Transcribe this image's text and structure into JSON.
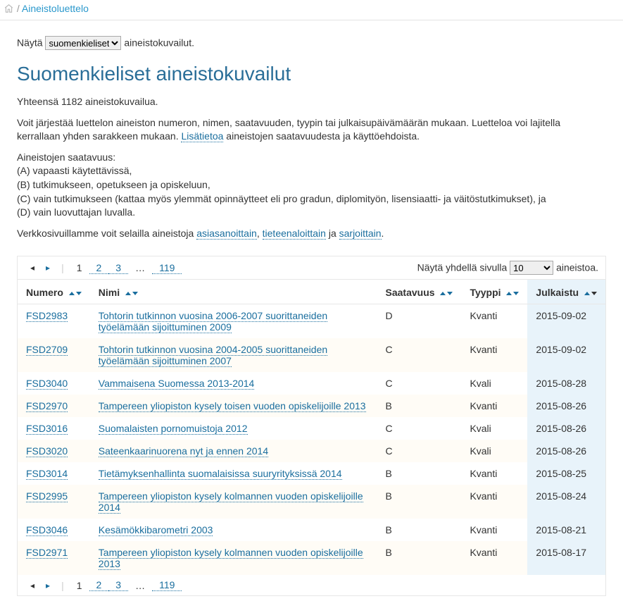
{
  "breadcrumb": {
    "home_icon": "home-icon",
    "sep": "/",
    "link": "Aineistoluettelo"
  },
  "filter": {
    "prefix": "Näytä",
    "select_value": "suomenkieliset",
    "suffix": "aineistokuvailut."
  },
  "heading": "Suomenkieliset aineistokuvailut",
  "total_line": "Yhteensä 1182 aineistokuvailua.",
  "intro": {
    "before_link": "Voit järjestää luettelon aineiston numeron, nimen, saatavuuden, tyypin tai julkaisupäivämäärän mukaan. Luetteloa voi lajitella kerrallaan yhden sarakkeen mukaan. ",
    "link": "Lisätietoa",
    "after_link": " aineistojen saatavuudesta ja käyttöehdoista."
  },
  "availability_block": {
    "title": "Aineistojen saatavuus:",
    "A": "(A) vapaasti käytettävissä,",
    "B": "(B) tutkimukseen, opetukseen ja opiskeluun,",
    "C": "(C) vain tutkimukseen (kattaa myös ylemmät opinnäytteet eli pro gradun, diplomityön, lisensiaatti- ja väitöstutkimukset), ja",
    "D": "(D) vain luovuttajan luvalla."
  },
  "browse_line": {
    "before": "Verkkosivuillamme voit selailla aineistoja ",
    "link1": "asiasanoittain",
    "sep1": ", ",
    "link2": "tieteenaloittain",
    "sep2": " ja ",
    "link3": "sarjoittain",
    "end": "."
  },
  "pager": {
    "prev": "◂",
    "next": "▸",
    "pipe": "|",
    "current": "1",
    "pages": [
      "2",
      "3"
    ],
    "ellipsis": "…",
    "last": "119",
    "right_prefix": "Näytä yhdellä sivulla",
    "per_page": "10",
    "right_suffix": "aineistoa."
  },
  "columns": {
    "num": "Numero",
    "name": "Nimi",
    "avail": "Saatavuus",
    "type": "Tyyppi",
    "date": "Julkaistu"
  },
  "rows": [
    {
      "num": "FSD2983",
      "name": "Tohtorin tutkinnon vuosina 2006-2007 suorittaneiden työelämään sijoittuminen 2009",
      "avail": "D",
      "type": "Kvanti",
      "date": "2015-09-02"
    },
    {
      "num": "FSD2709",
      "name": "Tohtorin tutkinnon vuosina 2004-2005 suorittaneiden työelämään sijoittuminen 2007",
      "avail": "C",
      "type": "Kvanti",
      "date": "2015-09-02"
    },
    {
      "num": "FSD3040",
      "name": "Vammaisena Suomessa 2013-2014",
      "avail": "C",
      "type": "Kvali",
      "date": "2015-08-28"
    },
    {
      "num": "FSD2970",
      "name": "Tampereen yliopiston kysely toisen vuoden opiskelijoille 2013",
      "avail": "B",
      "type": "Kvanti",
      "date": "2015-08-26"
    },
    {
      "num": "FSD3016",
      "name": "Suomalaisten pornomuistoja 2012",
      "avail": "C",
      "type": "Kvali",
      "date": "2015-08-26"
    },
    {
      "num": "FSD3020",
      "name": "Sateenkaarinuorena nyt ja ennen 2014",
      "avail": "C",
      "type": "Kvali",
      "date": "2015-08-26"
    },
    {
      "num": "FSD3014",
      "name": "Tietämyksenhallinta suomalaisissa suuryrityksissä 2014",
      "avail": "B",
      "type": "Kvanti",
      "date": "2015-08-25"
    },
    {
      "num": "FSD2995",
      "name": "Tampereen yliopiston kysely kolmannen vuoden opiskelijoille 2014",
      "avail": "B",
      "type": "Kvanti",
      "date": "2015-08-24"
    },
    {
      "num": "FSD3046",
      "name": "Kesämökkibarometri 2003",
      "avail": "B",
      "type": "Kvanti",
      "date": "2015-08-21"
    },
    {
      "num": "FSD2971",
      "name": "Tampereen yliopiston kysely kolmannen vuoden opiskelijoille 2013",
      "avail": "B",
      "type": "Kvanti",
      "date": "2015-08-17"
    }
  ]
}
